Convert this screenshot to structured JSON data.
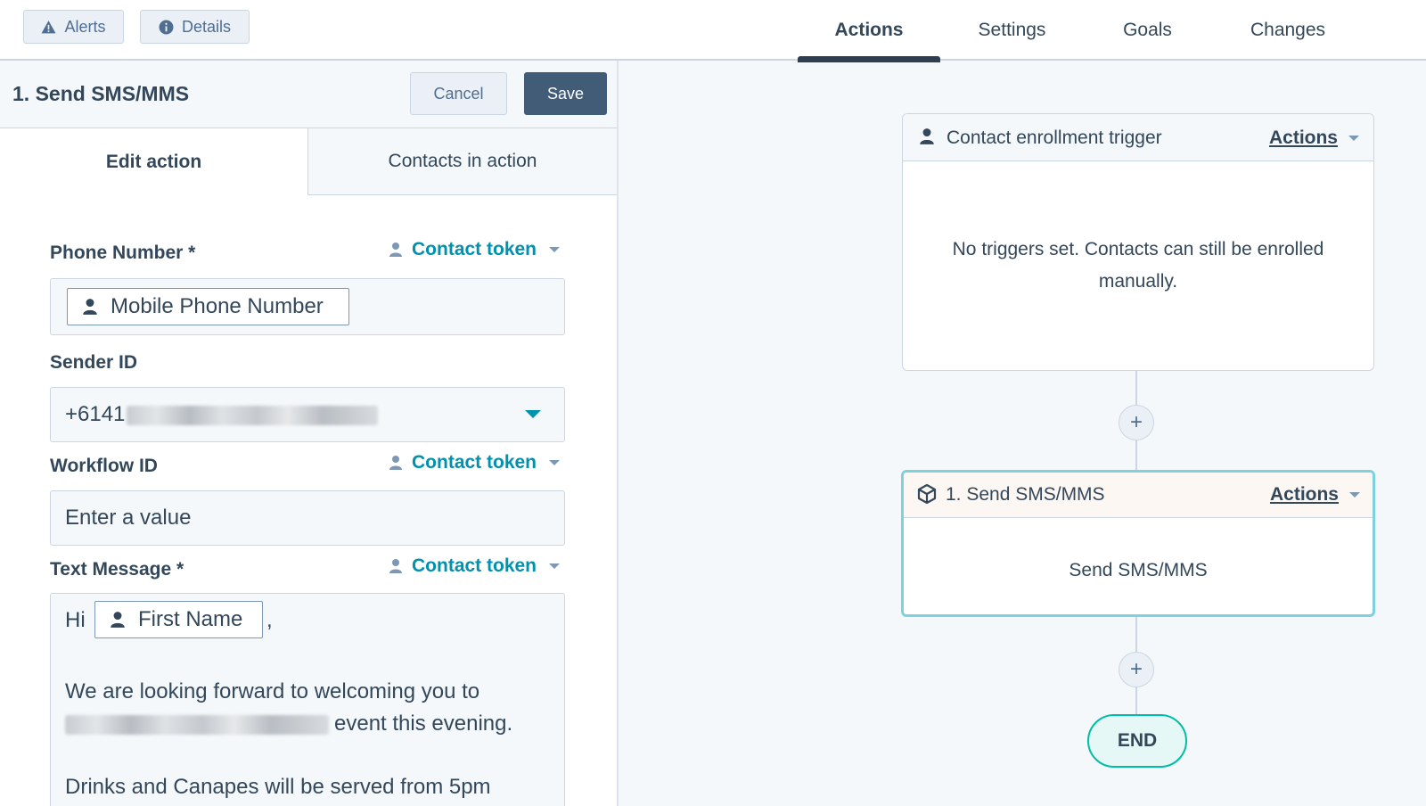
{
  "topbar": {
    "alerts_label": "Alerts",
    "details_label": "Details",
    "tabs": [
      {
        "label": "Actions",
        "active": true
      },
      {
        "label": "Settings",
        "active": false
      },
      {
        "label": "Goals",
        "active": false
      },
      {
        "label": "Changes",
        "active": false
      }
    ]
  },
  "panel": {
    "title": "1. Send SMS/MMS",
    "cancel_label": "Cancel",
    "save_label": "Save",
    "subtabs": [
      "Edit action",
      "Contacts in action"
    ],
    "fields": {
      "phone": {
        "label": "Phone Number *",
        "token_label": "Contact token",
        "chip": "Mobile Phone Number"
      },
      "sender": {
        "label": "Sender ID",
        "value_prefix": "+6141"
      },
      "workflow": {
        "label": "Workflow ID",
        "token_label": "Contact token",
        "placeholder": "Enter a value"
      },
      "message": {
        "label": "Text Message *",
        "token_label": "Contact token",
        "greeting": "Hi",
        "name_chip": "First Name",
        "comma": ",",
        "line2": "We are looking forward to welcoming you to",
        "line3_suffix": "event this evening.",
        "line4": "Drinks and Canapes will be served from 5pm"
      }
    }
  },
  "canvas": {
    "trigger_card": {
      "title": "Contact enrollment trigger",
      "actions_label": "Actions",
      "body_line1": "No triggers set. Contacts can still be enrolled",
      "body_line2": "manually."
    },
    "action_card": {
      "title": "1. Send SMS/MMS",
      "actions_label": "Actions",
      "body": "Send SMS/MMS"
    },
    "plus_symbol": "+",
    "end_label": "END"
  },
  "colors": {
    "accent": "#0091ae",
    "save_button": "#425b76",
    "active_tab_bar": "#2d3e50",
    "selected_card_border": "#7fd1de",
    "end_border": "#00bda5"
  },
  "icons": [
    "warning-icon",
    "info-icon",
    "contact-icon",
    "box-icon",
    "caret-down-icon"
  ]
}
